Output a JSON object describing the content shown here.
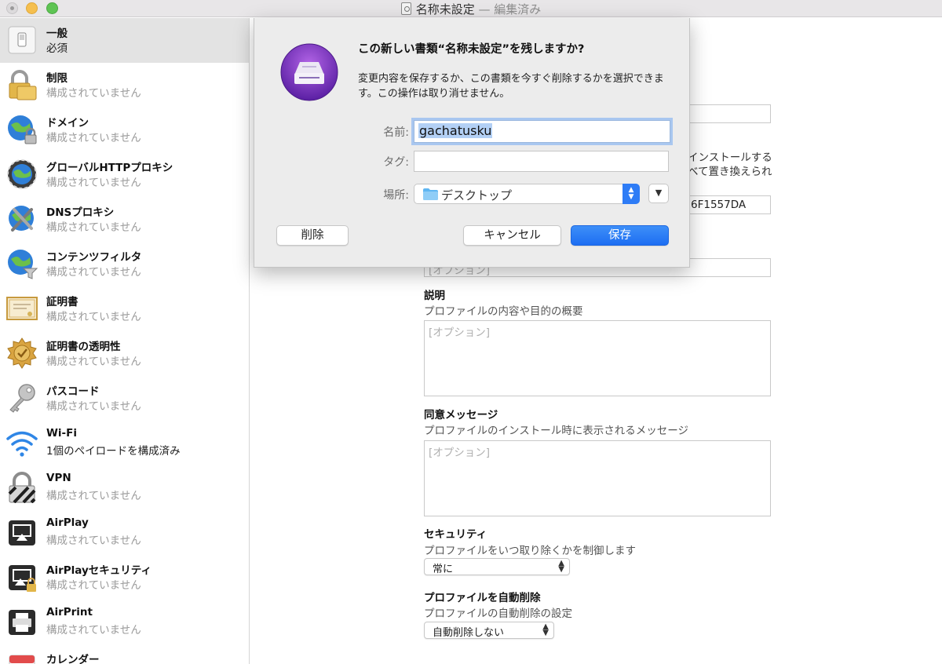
{
  "window": {
    "title": "名称未設定",
    "edited_suffix": "— 編集済み"
  },
  "sidebar": {
    "items": [
      {
        "name": "一般",
        "sub": "必須",
        "icon": "toggle-switch-icon",
        "selected": true
      },
      {
        "name": "制限",
        "sub": "構成されていません",
        "icon": "padlock-icon"
      },
      {
        "name": "ドメイン",
        "sub": "構成されていません",
        "icon": "globe-lock-icon"
      },
      {
        "name": "グローバルHTTPプロキシ",
        "sub": "構成されていません",
        "icon": "globe-proxy-icon"
      },
      {
        "name": "DNSプロキシ",
        "sub": "構成されていません",
        "icon": "globe-tools-icon"
      },
      {
        "name": "コンテンツフィルタ",
        "sub": "構成されていません",
        "icon": "globe-filter-icon"
      },
      {
        "name": "証明書",
        "sub": "構成されていません",
        "icon": "certificate-icon"
      },
      {
        "name": "証明書の透明性",
        "sub": "構成されていません",
        "icon": "certificate-seal-icon"
      },
      {
        "name": "パスコード",
        "sub": "構成されていません",
        "icon": "key-icon"
      },
      {
        "name": "Wi-Fi",
        "sub": "1個のペイロードを構成済み",
        "icon": "wifi-icon"
      },
      {
        "name": "VPN",
        "sub": "構成されていません",
        "icon": "vpn-lock-icon"
      },
      {
        "name": "AirPlay",
        "sub": "構成されていません",
        "icon": "airplay-icon"
      },
      {
        "name": "AirPlayセキュリティ",
        "sub": "構成されていません",
        "icon": "airplay-lock-icon"
      },
      {
        "name": "AirPrint",
        "sub": "構成されていません",
        "icon": "printer-icon"
      },
      {
        "name": "カレンダー",
        "sub": "",
        "icon": "calendar-icon"
      }
    ]
  },
  "main": {
    "partial_text_1": "インストールする",
    "partial_text_2": "べて置き換えられ",
    "partial_identifier": "6F1557DA",
    "option_placeholder": "[オプション]",
    "description": {
      "label": "説明",
      "hint": "プロファイルの内容や目的の概要",
      "placeholder": "[オプション]"
    },
    "consent": {
      "label": "同意メッセージ",
      "hint": "プロファイルのインストール時に表示されるメッセージ",
      "placeholder": "[オプション]"
    },
    "security": {
      "label": "セキュリティ",
      "hint": "プロファイルをいつ取り除くかを制御します",
      "value": "常に"
    },
    "auto_remove": {
      "label": "プロファイルを自動削除",
      "hint": "プロファイルの自動削除の設定",
      "value": "自動削除しない"
    }
  },
  "sheet": {
    "title": "この新しい書類“名称未設定”を残しますか?",
    "message": "変更内容を保存するか、この書類を今すぐ削除するかを選択できます。この操作は取り消せません。",
    "name_label": "名前:",
    "name_value": "gachatusku",
    "tag_label": "タグ:",
    "location_label": "場所:",
    "location_value": "デスクトップ",
    "delete_button": "削除",
    "cancel_button": "キャンセル",
    "save_button": "保存",
    "accent_color": "#1d6ef2",
    "app_icon": "configurator-icon"
  }
}
